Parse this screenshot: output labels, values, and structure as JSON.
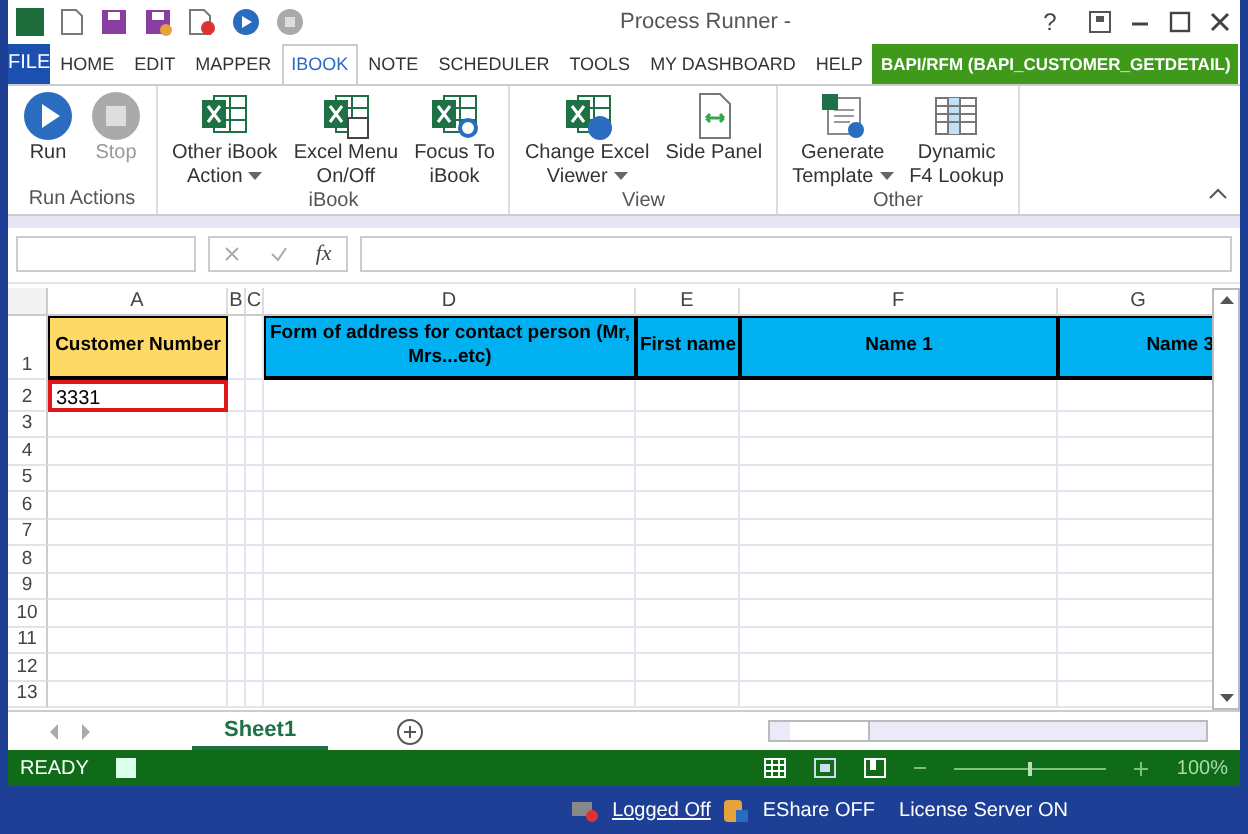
{
  "window": {
    "title": "Process Runner -",
    "help": "?"
  },
  "ribbon": {
    "file_tab": "FILE",
    "tabs": [
      {
        "label": "HOME",
        "selected": false
      },
      {
        "label": "EDIT",
        "selected": false
      },
      {
        "label": "MAPPER",
        "selected": false
      },
      {
        "label": "IBOOK",
        "selected": true
      },
      {
        "label": "NOTE",
        "selected": false
      },
      {
        "label": "SCHEDULER",
        "selected": false
      },
      {
        "label": "TOOLS",
        "selected": false
      },
      {
        "label": "MY DASHBOARD",
        "selected": false
      },
      {
        "label": "HELP",
        "selected": false
      }
    ],
    "context_tab": "BAPI/RFM (BAPI_CUSTOMER_GETDETAIL)",
    "groups": [
      {
        "label": "Run Actions",
        "buttons": [
          {
            "kind": "run",
            "lines": [
              "Run"
            ],
            "disabled": false,
            "dropdown": false
          },
          {
            "kind": "stop",
            "lines": [
              "Stop"
            ],
            "disabled": true,
            "dropdown": false
          }
        ]
      },
      {
        "label": "iBook",
        "buttons": [
          {
            "kind": "excel",
            "lines": [
              "Other iBook",
              "Action"
            ],
            "disabled": false,
            "dropdown": true
          },
          {
            "kind": "excel-window",
            "lines": [
              "Excel Menu",
              "On/Off"
            ],
            "disabled": false,
            "dropdown": false
          },
          {
            "kind": "excel-search",
            "lines": [
              "Focus To",
              "iBook"
            ],
            "disabled": false,
            "dropdown": false
          }
        ]
      },
      {
        "label": "View",
        "buttons": [
          {
            "kind": "excel-viewer",
            "lines": [
              "Change Excel",
              "Viewer"
            ],
            "disabled": false,
            "dropdown": true
          },
          {
            "kind": "side-panel",
            "lines": [
              "Side Panel"
            ],
            "disabled": false,
            "dropdown": false
          }
        ]
      },
      {
        "label": "Other",
        "buttons": [
          {
            "kind": "template",
            "lines": [
              "Generate",
              "Template"
            ],
            "disabled": false,
            "dropdown": true
          },
          {
            "kind": "table",
            "lines": [
              "Dynamic",
              "F4 Lookup"
            ],
            "disabled": false,
            "dropdown": false
          }
        ]
      }
    ]
  },
  "formula_bar": {
    "function_label": "fx"
  },
  "sheet": {
    "columns": [
      {
        "letter": "A",
        "header": {
          "text": "Customer Number",
          "color": "#ffd966"
        },
        "value": {
          "text": "3331",
          "selected": true
        }
      },
      {
        "letter": "B"
      },
      {
        "letter": "C"
      },
      {
        "letter": "D",
        "header": {
          "text": "Form of address for contact person (Mr, Mrs...etc)",
          "color": "#00b0f0"
        }
      },
      {
        "letter": "E",
        "header": {
          "text": "First name",
          "color": "#00b0f0"
        }
      },
      {
        "letter": "F",
        "header": {
          "text": "Name 1",
          "color": "#00b0f0"
        }
      },
      {
        "letter": "G",
        "header": {
          "text": "Name 3",
          "color": "#00b0f0"
        }
      }
    ],
    "rows": [
      "1",
      "2",
      "3",
      "4",
      "5",
      "6",
      "7",
      "8",
      "9",
      "10",
      "11",
      "12",
      "13"
    ]
  },
  "sheet_tabs": [
    {
      "label": "Sheet1",
      "selected": true
    }
  ],
  "status_bar": {
    "status": "READY",
    "zoom_slider": {
      "level": 0.5
    },
    "zoom": "100%"
  },
  "taskbar": {
    "login": "Logged Off",
    "eshare": "EShare OFF",
    "license": "License Server ON"
  }
}
